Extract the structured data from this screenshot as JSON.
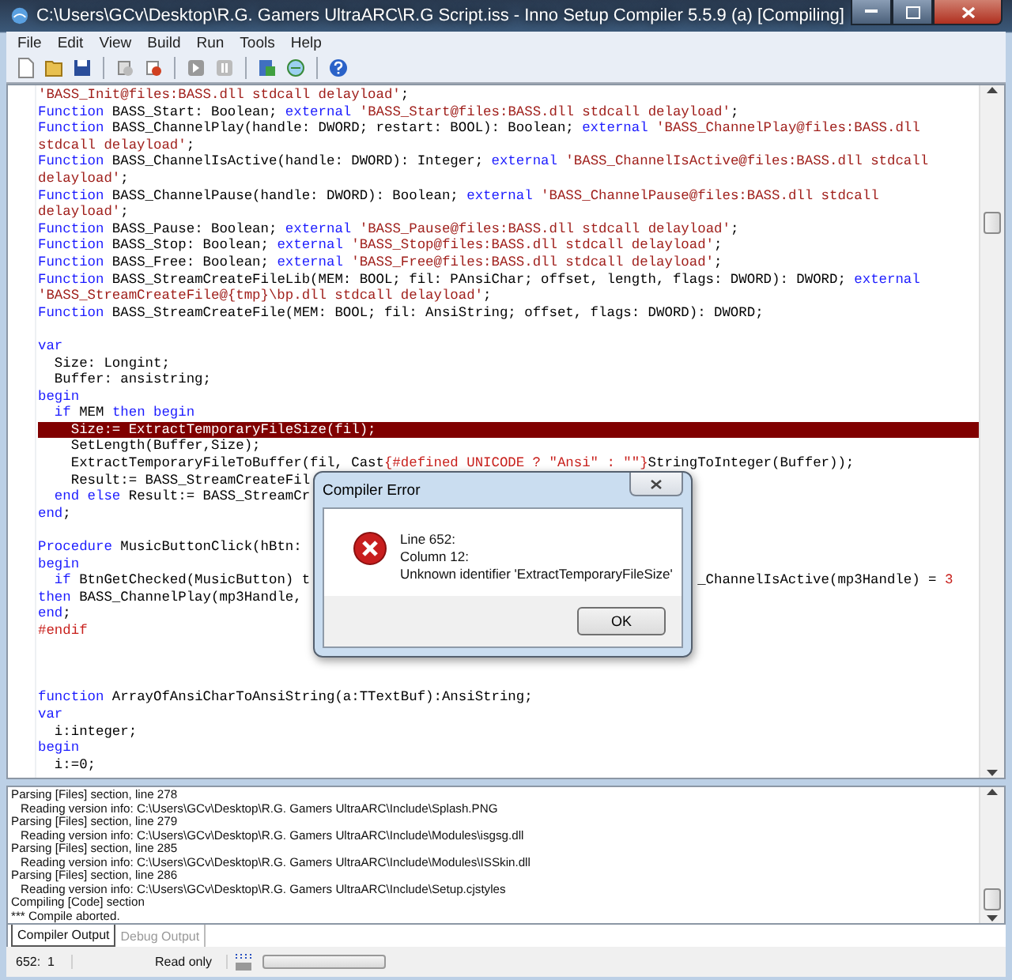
{
  "window": {
    "title": "C:\\Users\\GCv\\Desktop\\R.G. Gamers UltraARC\\R.G Script.iss - Inno Setup Compiler 5.5.9 (a)  [Compiling]"
  },
  "menu": [
    "File",
    "Edit",
    "View",
    "Build",
    "Run",
    "Tools",
    "Help"
  ],
  "editor": {
    "lines": [
      {
        "highlighted": false,
        "tokens": [
          {
            "kind": "str",
            "text": "'BASS_Init@files:BASS.dll stdcall delayload'"
          },
          {
            "kind": "plain",
            "text": ";"
          }
        ]
      },
      {
        "highlighted": false,
        "tokens": [
          {
            "kind": "kw",
            "text": "Function"
          },
          {
            "kind": "plain",
            "text": " BASS_Start: Boolean; "
          },
          {
            "kind": "kw",
            "text": "external"
          },
          {
            "kind": "str",
            "text": " 'BASS_Start@files:BASS.dll stdcall delayload'"
          },
          {
            "kind": "plain",
            "text": ";"
          }
        ]
      },
      {
        "highlighted": false,
        "tokens": [
          {
            "kind": "kw",
            "text": "Function"
          },
          {
            "kind": "plain",
            "text": " BASS_ChannelPlay(handle: DWORD; restart: BOOL): Boolean; "
          },
          {
            "kind": "kw",
            "text": "external"
          },
          {
            "kind": "str",
            "text": " 'BASS_ChannelPlay@files:BASS.dll"
          }
        ]
      },
      {
        "highlighted": false,
        "tokens": [
          {
            "kind": "str",
            "text": "stdcall delayload'"
          },
          {
            "kind": "plain",
            "text": ";"
          }
        ]
      },
      {
        "highlighted": false,
        "tokens": [
          {
            "kind": "kw",
            "text": "Function"
          },
          {
            "kind": "plain",
            "text": " BASS_ChannelIsActive(handle: DWORD): Integer; "
          },
          {
            "kind": "kw",
            "text": "external"
          },
          {
            "kind": "str",
            "text": " 'BASS_ChannelIsActive@files:BASS.dll stdcall"
          }
        ]
      },
      {
        "highlighted": false,
        "tokens": [
          {
            "kind": "str",
            "text": "delayload'"
          },
          {
            "kind": "plain",
            "text": ";"
          }
        ]
      },
      {
        "highlighted": false,
        "tokens": [
          {
            "kind": "kw",
            "text": "Function"
          },
          {
            "kind": "plain",
            "text": " BASS_ChannelPause(handle: DWORD): Boolean; "
          },
          {
            "kind": "kw",
            "text": "external"
          },
          {
            "kind": "str",
            "text": " 'BASS_ChannelPause@files:BASS.dll stdcall"
          }
        ]
      },
      {
        "highlighted": false,
        "tokens": [
          {
            "kind": "str",
            "text": "delayload'"
          },
          {
            "kind": "plain",
            "text": ";"
          }
        ]
      },
      {
        "highlighted": false,
        "tokens": [
          {
            "kind": "kw",
            "text": "Function"
          },
          {
            "kind": "plain",
            "text": " BASS_Pause: Boolean; "
          },
          {
            "kind": "kw",
            "text": "external"
          },
          {
            "kind": "str",
            "text": " 'BASS_Pause@files:BASS.dll stdcall delayload'"
          },
          {
            "kind": "plain",
            "text": ";"
          }
        ]
      },
      {
        "highlighted": false,
        "tokens": [
          {
            "kind": "kw",
            "text": "Function"
          },
          {
            "kind": "plain",
            "text": " BASS_Stop: Boolean; "
          },
          {
            "kind": "kw",
            "text": "external"
          },
          {
            "kind": "str",
            "text": " 'BASS_Stop@files:BASS.dll stdcall delayload'"
          },
          {
            "kind": "plain",
            "text": ";"
          }
        ]
      },
      {
        "highlighted": false,
        "tokens": [
          {
            "kind": "kw",
            "text": "Function"
          },
          {
            "kind": "plain",
            "text": " BASS_Free: Boolean; "
          },
          {
            "kind": "kw",
            "text": "external"
          },
          {
            "kind": "str",
            "text": " 'BASS_Free@files:BASS.dll stdcall delayload'"
          },
          {
            "kind": "plain",
            "text": ";"
          }
        ]
      },
      {
        "highlighted": false,
        "tokens": [
          {
            "kind": "kw",
            "text": "Function"
          },
          {
            "kind": "plain",
            "text": " BASS_StreamCreateFileLib(MEM: BOOL; fil: PAnsiChar; offset, length, flags: DWORD): DWORD; "
          },
          {
            "kind": "kw",
            "text": "external"
          }
        ]
      },
      {
        "highlighted": false,
        "tokens": [
          {
            "kind": "str",
            "text": "'BASS_StreamCreateFile@{tmp}\\bp.dll stdcall delayload'"
          },
          {
            "kind": "plain",
            "text": ";"
          }
        ]
      },
      {
        "highlighted": false,
        "tokens": [
          {
            "kind": "kw",
            "text": "Function"
          },
          {
            "kind": "plain",
            "text": " BASS_StreamCreateFile(MEM: BOOL; fil: AnsiString; offset, flags: DWORD): DWORD;"
          }
        ]
      },
      {
        "highlighted": false
      },
      {
        "highlighted": false,
        "tokens": [
          {
            "kind": "kw",
            "text": "var"
          }
        ]
      },
      {
        "highlighted": false,
        "tokens": [
          {
            "kind": "plain",
            "text": "  Size: Longint;"
          }
        ]
      },
      {
        "highlighted": false,
        "tokens": [
          {
            "kind": "plain",
            "text": "  Buffer: ansistring;"
          }
        ]
      },
      {
        "highlighted": false,
        "tokens": [
          {
            "kind": "kw",
            "text": "begin"
          }
        ]
      },
      {
        "highlighted": false,
        "tokens": [
          {
            "kind": "kw",
            "text": "  if"
          },
          {
            "kind": "plain",
            "text": " MEM "
          },
          {
            "kind": "kw",
            "text": "then begin"
          }
        ]
      },
      {
        "highlighted": true,
        "tokens": [
          {
            "kind": "plain",
            "text": "    Size:= ExtractTemporaryFileSize(fil);"
          }
        ]
      },
      {
        "highlighted": false,
        "tokens": [
          {
            "kind": "plain",
            "text": "    SetLength(Buffer,Size);"
          }
        ]
      },
      {
        "highlighted": false,
        "tokens": [
          {
            "kind": "plain",
            "text": "    ExtractTemporaryFileToBuffer(fil, Cast"
          },
          {
            "kind": "pp",
            "text": "{#defined UNICODE ? \"Ansi\" : \"\"}"
          },
          {
            "kind": "plain",
            "text": "StringToInteger(Buffer));"
          }
        ]
      },
      {
        "highlighted": false,
        "tokens": [
          {
            "kind": "plain",
            "text": "    Result:= BASS_StreamCreateFil"
          }
        ]
      },
      {
        "highlighted": false,
        "tokens": [
          {
            "kind": "kw",
            "text": "  end else"
          },
          {
            "kind": "plain",
            "text": " Result:= BASS_StreamCr"
          }
        ]
      },
      {
        "highlighted": false,
        "tokens": [
          {
            "kind": "kw",
            "text": "end"
          },
          {
            "kind": "plain",
            "text": ";"
          }
        ]
      },
      {
        "highlighted": false
      },
      {
        "highlighted": false,
        "tokens": [
          {
            "kind": "kw",
            "text": "Procedure"
          },
          {
            "kind": "plain",
            "text": " MusicButtonClick(hBtn:"
          }
        ]
      },
      {
        "highlighted": false,
        "tokens": [
          {
            "kind": "kw",
            "text": "begin"
          }
        ]
      },
      {
        "highlighted": false,
        "tokens": [
          {
            "kind": "kw",
            "text": "  if"
          },
          {
            "kind": "plain",
            "text": " BtnGetChecked(MusicButton) t"
          }
        ],
        "after_dialog": [
          {
            "kind": "plain",
            "text": "_ChannelIsActive(mp3Handle) = "
          },
          {
            "kind": "pp",
            "text": "3"
          }
        ]
      },
      {
        "highlighted": false,
        "tokens": [
          {
            "kind": "kw",
            "text": "then"
          },
          {
            "kind": "plain",
            "text": " BASS_ChannelPlay(mp3Handle,"
          }
        ]
      },
      {
        "highlighted": false,
        "tokens": [
          {
            "kind": "kw",
            "text": "end"
          },
          {
            "kind": "plain",
            "text": ";"
          }
        ]
      },
      {
        "highlighted": false,
        "tokens": [
          {
            "kind": "pp",
            "text": "#endif"
          }
        ]
      },
      {
        "highlighted": false
      },
      {
        "highlighted": false
      },
      {
        "highlighted": false
      },
      {
        "highlighted": false,
        "tokens": [
          {
            "kind": "kw",
            "text": "function"
          },
          {
            "kind": "plain",
            "text": " ArrayOfAnsiCharToAnsiString(a:TTextBuf):AnsiString;"
          }
        ]
      },
      {
        "highlighted": false,
        "tokens": [
          {
            "kind": "kw",
            "text": "var"
          }
        ]
      },
      {
        "highlighted": false,
        "tokens": [
          {
            "kind": "plain",
            "text": "  i:integer;"
          }
        ]
      },
      {
        "highlighted": false,
        "tokens": [
          {
            "kind": "kw",
            "text": "begin"
          }
        ]
      },
      {
        "highlighted": false,
        "tokens": [
          {
            "kind": "plain",
            "text": "  i:=0;"
          }
        ]
      }
    ]
  },
  "dialog": {
    "title": "Compiler Error",
    "message": [
      "Line 652:",
      "Column 12:",
      "Unknown identifier 'ExtractTemporaryFileSize'"
    ],
    "button": "OK"
  },
  "output": {
    "entries": [
      {
        "text": "Parsing [Files] section, line 278",
        "children": [
          {
            "text": "Reading version info: C:\\Users\\GCv\\Desktop\\R.G. Gamers UltraARC\\Include\\Splash.PNG"
          }
        ]
      },
      {
        "text": "Parsing [Files] section, line 279",
        "children": [
          {
            "text": "Reading version info: C:\\Users\\GCv\\Desktop\\R.G. Gamers UltraARC\\Include\\Modules\\isgsg.dll"
          }
        ]
      },
      {
        "text": "Parsing [Files] section, line 285",
        "children": [
          {
            "text": "Reading version info: C:\\Users\\GCv\\Desktop\\R.G. Gamers UltraARC\\Include\\Modules\\ISSkin.dll"
          }
        ]
      },
      {
        "text": "Parsing [Files] section, line 286",
        "children": [
          {
            "text": "Reading version info: C:\\Users\\GCv\\Desktop\\R.G. Gamers UltraARC\\Include\\Setup.cjstyles"
          }
        ]
      },
      {
        "text": "Compiling [Code] section"
      },
      {
        "text": "*** Compile aborted."
      }
    ]
  },
  "tabs": [
    {
      "label": "Compiler Output",
      "selected": true
    },
    {
      "label": "Debug Output",
      "selected": false
    }
  ],
  "status_bar": {
    "position": "652:  1",
    "mode": "Read only",
    "progress": {
      "level": 0
    }
  }
}
